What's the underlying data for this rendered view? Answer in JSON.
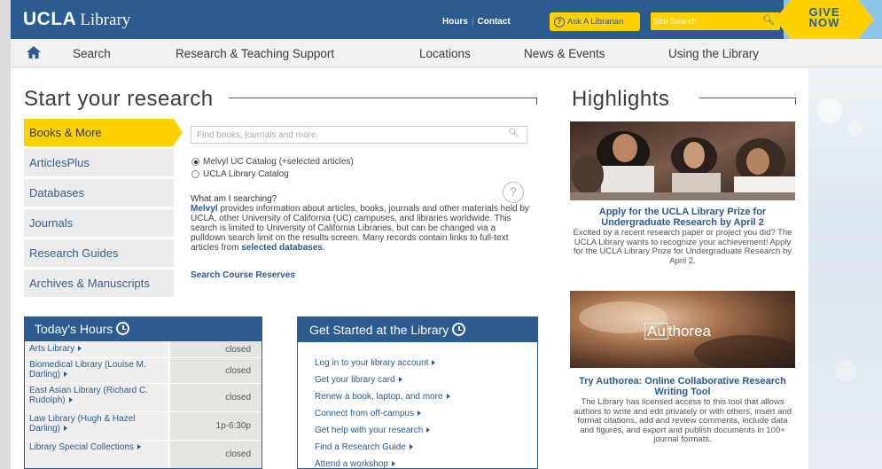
{
  "header": {
    "logo_ucla": "UCLA",
    "logo_library": "Library",
    "link_hours": "Hours",
    "link_contact": "Contact",
    "ask_label": "Ask A Librarian",
    "site_search_placeholder": "Site Search",
    "give_line1": "GIVE",
    "give_line2": "NOW"
  },
  "nav": {
    "items": [
      "Search",
      "Research & Teaching Support",
      "Locations",
      "News & Events",
      "Using the Library"
    ]
  },
  "research": {
    "title": "Start your research",
    "tabs": [
      "Books & More",
      "ArticlesPlus",
      "Databases",
      "Journals",
      "Research Guides",
      "Archives & Manuscripts"
    ],
    "search_placeholder": "Find books, journals and more.",
    "options": [
      "Melvyl UC Catalog (+selected articles)",
      "UCLA Library Catalog"
    ],
    "what_title": "What am I searching?",
    "melvyl": "Melvyl",
    "what_text": " provides information about articles, books, journals and other materials held by UCLA, other University of California (UC) campuses, and libraries worldwide. This search is limited to University of California Libraries, but can be changed via a pulldown search limit on the results screen. Many records contain links to full-text articles from ",
    "what_link": "selected databases",
    "what_end": ".",
    "course_reserves": "Search Course Reserves"
  },
  "hours": {
    "title": "Today's Hours",
    "rows": [
      {
        "name": "Arts Library",
        "time": "closed"
      },
      {
        "name": "Biomedical Library (Louise M. Darling)",
        "time": "closed"
      },
      {
        "name": "East Asian Library (Richard C. Rudolph)",
        "time": "closed"
      },
      {
        "name": "Law Library (Hugh & Hazel Darling)",
        "time": "1p-6:30p"
      },
      {
        "name": "Library Special Collections",
        "time": "closed"
      }
    ]
  },
  "started": {
    "title": "Get Started at the Library",
    "links": [
      "Log in to your library account",
      "Get your library card",
      "Renew a book, laptop, and more",
      "Connect from off-campus",
      "Get help with your research",
      "Find a Research Guide",
      "Attend a workshop"
    ]
  },
  "highlights": {
    "title": "Highlights",
    "items": [
      {
        "title": "Apply for the UCLA Library Prize for Undergraduate Research by April 2",
        "desc": "Excited by a recent research paper or project you did? The UCLA Library wants to recognize your achievement! Apply for the UCLA Library Prize for Undergraduate Research by April 2."
      },
      {
        "logo": "Authorea",
        "logo_au": "Au",
        "logo_rest": "thorea",
        "title": "Try Authorea: Online Collaborative Research Writing Tool",
        "desc": "The Library has licensed access to this tool that allows authors to write and edit privately or with others, insert and format citations, add and review comments, include data and figures, and export and publish documents in 100+ journal formats."
      }
    ]
  },
  "colors": {
    "brand_blue": "#2b5b8f",
    "brand_gold": "#ffd100"
  }
}
